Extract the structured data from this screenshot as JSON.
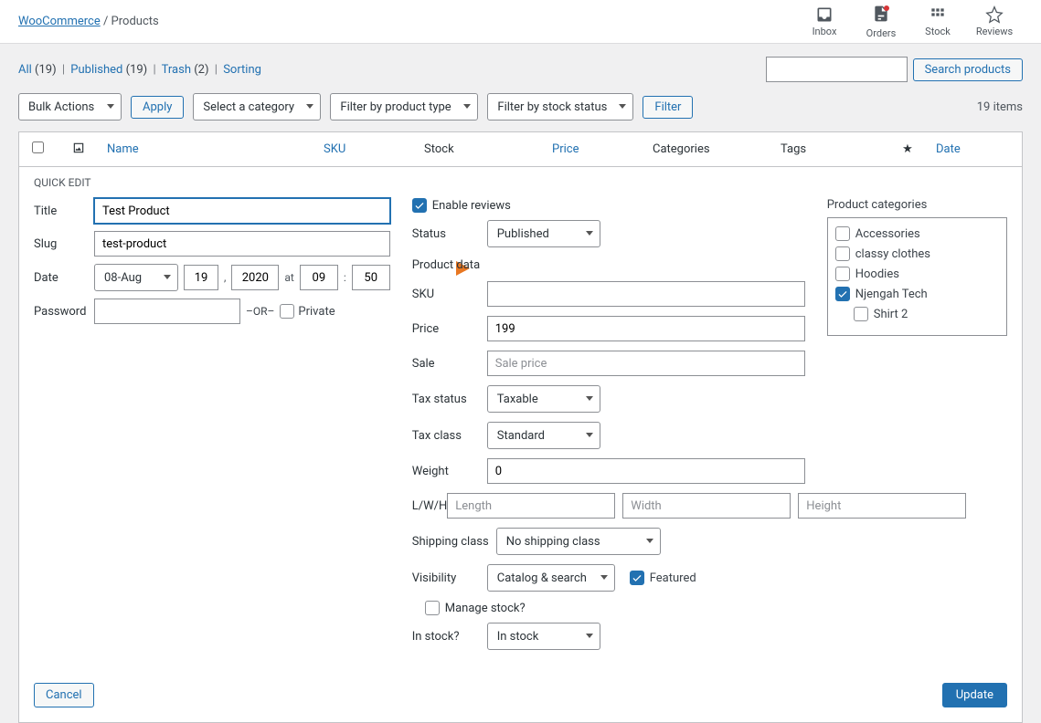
{
  "breadcrumb": {
    "parent": "WooCommerce",
    "current": "Products"
  },
  "top_icons": {
    "inbox": "Inbox",
    "orders": "Orders",
    "stock": "Stock",
    "reviews": "Reviews"
  },
  "view_links": {
    "all": "All",
    "all_count": "(19)",
    "published": "Published",
    "published_count": "(19)",
    "trash": "Trash",
    "trash_count": "(2)",
    "sorting": "Sorting"
  },
  "search_btn": "Search products",
  "filters": {
    "bulk": "Bulk Actions",
    "apply": "Apply",
    "category": "Select a category",
    "type": "Filter by product type",
    "stock": "Filter by stock status",
    "filter_btn": "Filter",
    "items": "19 items"
  },
  "columns": {
    "name": "Name",
    "sku": "SKU",
    "stock": "Stock",
    "price": "Price",
    "categories": "Categories",
    "tags": "Tags",
    "date": "Date"
  },
  "quick_edit": {
    "heading": "QUICK EDIT",
    "labels": {
      "title": "Title",
      "slug": "Slug",
      "date": "Date",
      "password": "Password",
      "or": "–OR–",
      "private": "Private",
      "at": "at",
      "colon": ":",
      "comma": ","
    },
    "title_val": "Test Product",
    "slug_val": "test-product",
    "month": "08-Aug",
    "day": "19",
    "year": "2020",
    "hour": "09",
    "minute": "50",
    "password_val": ""
  },
  "mid": {
    "enable_reviews": "Enable reviews",
    "status_label": "Status",
    "status_val": "Published",
    "product_data": "Product data",
    "sku_label": "SKU",
    "sku_val": "",
    "price_label": "Price",
    "price_val": "199",
    "sale_label": "Sale",
    "sale_ph": "Sale price",
    "tax_status_label": "Tax status",
    "tax_status_val": "Taxable",
    "tax_class_label": "Tax class",
    "tax_class_val": "Standard",
    "weight_label": "Weight",
    "weight_val": "0",
    "lwh_label": "L/W/H",
    "l_ph": "Length",
    "w_ph": "Width",
    "h_ph": "Height",
    "shipping_label": "Shipping class",
    "shipping_val": "No shipping class",
    "visibility_label": "Visibility",
    "visibility_val": "Catalog & search",
    "featured": "Featured",
    "manage_stock": "Manage stock?",
    "instock_label": "In stock?",
    "instock_val": "In stock"
  },
  "cats": {
    "heading": "Product categories",
    "items": [
      {
        "label": "Accessories",
        "checked": false,
        "indent": false
      },
      {
        "label": "classy clothes",
        "checked": false,
        "indent": false
      },
      {
        "label": "Hoodies",
        "checked": false,
        "indent": false
      },
      {
        "label": "Njengah Tech",
        "checked": true,
        "indent": false
      },
      {
        "label": "Shirt 2",
        "checked": false,
        "indent": true
      }
    ]
  },
  "footer": {
    "cancel": "Cancel",
    "update": "Update"
  }
}
